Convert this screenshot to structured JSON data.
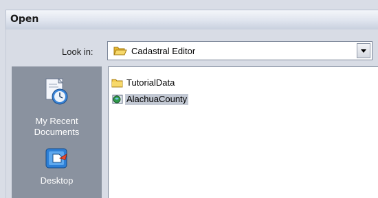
{
  "dialog": {
    "title": "Open"
  },
  "look_in": {
    "label": "Look in:",
    "current_folder": "Cadastral Editor",
    "folder_icon": "folder-open-icon",
    "dropdown_icon": "chevron-down-icon"
  },
  "places": [
    {
      "label": "My Recent Documents",
      "icon": "recent-documents-icon"
    },
    {
      "label": "Desktop",
      "icon": "desktop-icon"
    }
  ],
  "files": [
    {
      "name": "TutorialData",
      "icon": "folder-icon",
      "selected": false
    },
    {
      "name": "AlachuaCounty",
      "icon": "geodatabase-icon",
      "selected": true
    }
  ],
  "colors": {
    "places_bar": "#8a929f",
    "selection": "#c2c8d3",
    "dialog_bg": "#d8dce5",
    "folder": "#f2c94c"
  }
}
